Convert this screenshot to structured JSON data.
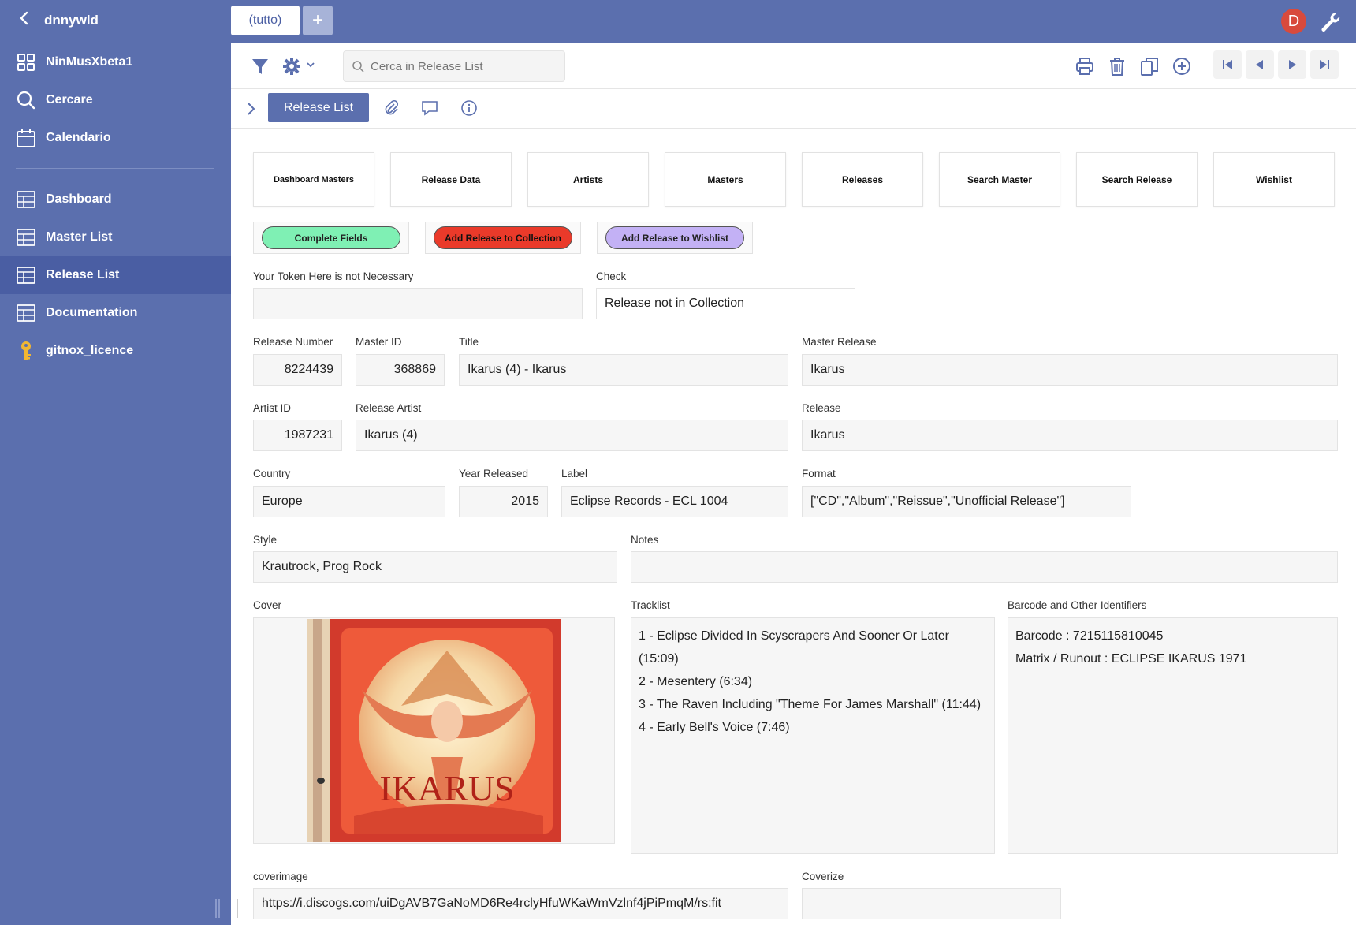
{
  "sidebar": {
    "user": "dnnywld",
    "items": [
      {
        "label": "NinMusXbeta1",
        "icon": "grid-icon"
      },
      {
        "label": "Cercare",
        "icon": "search-icon"
      },
      {
        "label": "Calendario",
        "icon": "calendar-icon"
      },
      {
        "label": "Dashboard",
        "icon": "table-icon"
      },
      {
        "label": "Master List",
        "icon": "table-icon"
      },
      {
        "label": "Release List",
        "icon": "table-icon",
        "active": true
      },
      {
        "label": "Documentation",
        "icon": "table-icon"
      },
      {
        "label": "gitnox_licence",
        "icon": "key-icon"
      }
    ]
  },
  "topbar": {
    "tab_label": "(tutto)",
    "add_tab": "+",
    "avatar_letter": "D"
  },
  "toolbar": {
    "search_placeholder": "Cerca in Release List"
  },
  "subbar": {
    "active_tab": "Release List"
  },
  "nav_buttons": [
    "Dashboard Masters",
    "Release Data",
    "Artists",
    "Masters",
    "Releases",
    "Search Master",
    "Search Release",
    "Wishlist"
  ],
  "action_buttons": [
    {
      "label": "Complete Fields",
      "color": "#7ff0b4"
    },
    {
      "label": "Add Release to Collection",
      "color": "#ea3a2a"
    },
    {
      "label": "Add Release to Wishlist",
      "color": "#c3b1f5"
    }
  ],
  "form": {
    "token_label": "Your Token Here is not Necessary",
    "token_value": "",
    "check_label": "Check",
    "check_value": "Release not in Collection",
    "release_number_label": "Release Number",
    "release_number": "8224439",
    "master_id_label": "Master ID",
    "master_id": "368869",
    "title_label": "Title",
    "title": "Ikarus (4) - Ikarus",
    "master_release_label": "Master Release",
    "master_release": "Ikarus",
    "artist_id_label": "Artist ID",
    "artist_id": "1987231",
    "release_artist_label": "Release Artist",
    "release_artist": "Ikarus (4)",
    "release_label": "Release",
    "release": "Ikarus",
    "country_label": "Country",
    "country": "Europe",
    "year_label": "Year Released",
    "year": "2015",
    "label_label": "Label",
    "label": "Eclipse Records - ECL 1004",
    "format_label": "Format",
    "format": "[\"CD\",\"Album\",\"Reissue\",\"Unofficial Release\"]",
    "style_label": "Style",
    "style": "Krautrock, Prog Rock",
    "notes_label": "Notes",
    "notes": "",
    "cover_label": "Cover",
    "cover_text": "IKARUS",
    "tracklist_label": "Tracklist",
    "tracklist": [
      "1 - Eclipse Divided In Scyscrapers And Sooner Or Later",
      "(15:09)",
      "2 - Mesentery (6:34)",
      "3 - The Raven Including \"Theme For James Marshall\" (11:44)",
      "4 - Early Bell's Voice (7:46)"
    ],
    "barcode_label": "Barcode and Other Identifiers",
    "barcodes": [
      "Barcode : 7215115810045",
      "Matrix / Runout : ECLIPSE  IKARUS 1971"
    ],
    "coverimage_label": "coverimage",
    "coverimage": "https://i.discogs.com/uiDgAVB7GaNoMD6Re4rclyHfuWKaWmVzlnf4jPiPmqM/rs:fit",
    "coverize_label": "Coverize",
    "coverize": ""
  }
}
